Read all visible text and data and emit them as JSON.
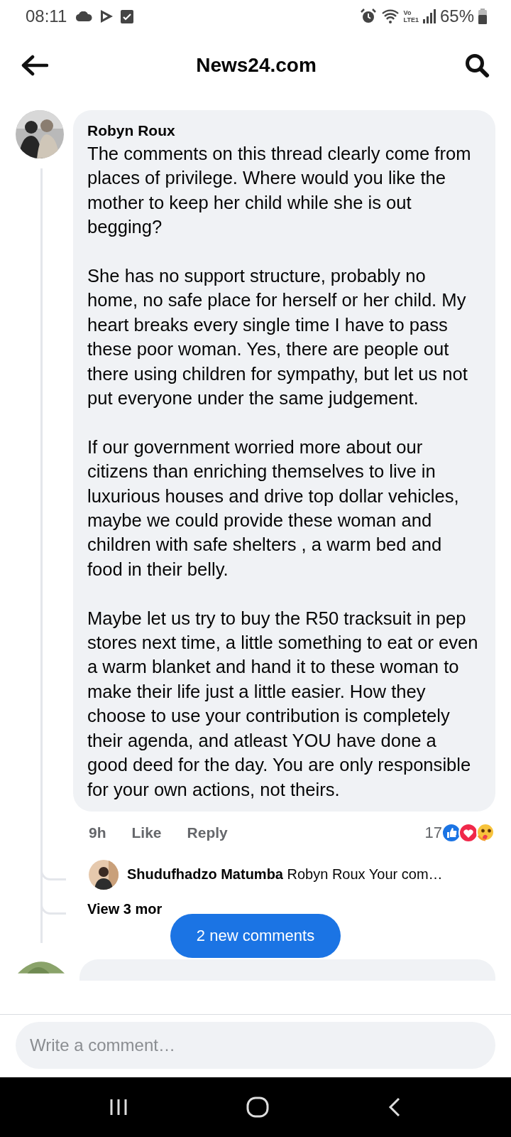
{
  "status_bar": {
    "time": "08:11",
    "volte_top": "Vo",
    "volte_bottom": "LTE1",
    "battery": "65%"
  },
  "header": {
    "title": "News24.com"
  },
  "comment": {
    "author": "Robyn Roux",
    "paragraphs": [
      "The comments on this thread clearly come from places of privilege. Where would you like the mother to keep her child while she is out begging?",
      "She has no support structure, probably no home, no safe place for herself or her child. My heart breaks every single time I have to pass these poor woman. Yes, there are people out there using children for sympathy, but let us not put everyone under the same judgement.",
      "If our government worried more about our citizens than enriching themselves to live in luxurious houses and drive top dollar vehicles, maybe we could provide these woman and children with safe shelters , a warm bed and food in their belly.",
      "Maybe let us try to buy the R50 tracksuit in pep stores next time, a little something to eat or even a warm blanket and hand it to these woman to make their life just a little easier. How they choose to use your contribution is completely their agenda, and atleast YOU have done a good deed for the day. You are only responsible for your own actions, not theirs."
    ],
    "time": "9h",
    "actions": [
      "Like",
      "Reply"
    ],
    "reaction_count": "17"
  },
  "reply": {
    "author": "Shudufhadzo Matumba",
    "preview": "Robyn Roux Your com…"
  },
  "more_replies": "View 3 mor",
  "new_comments": "2 new comments",
  "composer": {
    "placeholder": "Write a comment…"
  }
}
